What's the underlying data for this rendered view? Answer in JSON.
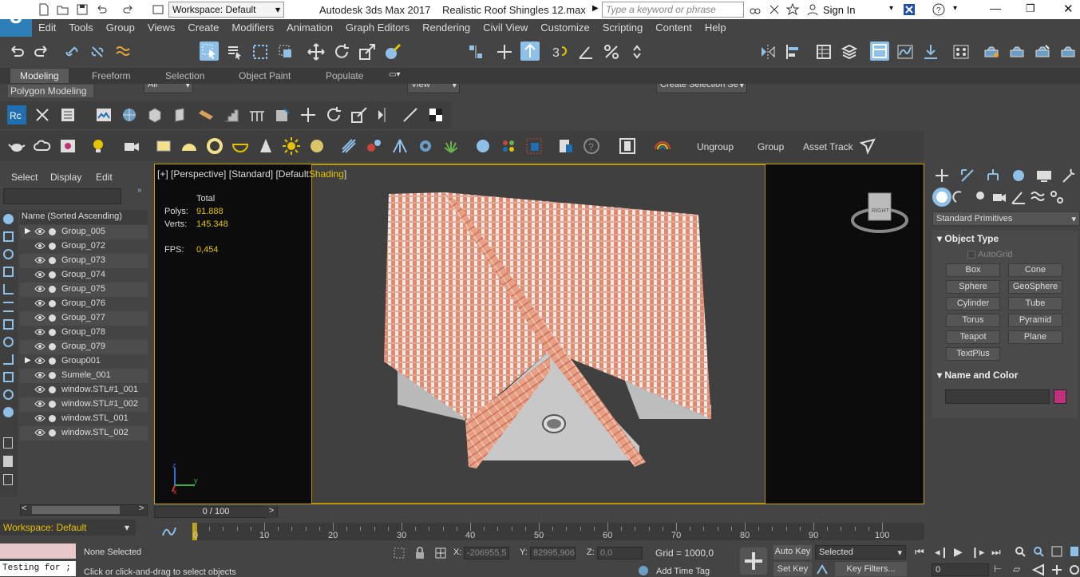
{
  "title_bar": {
    "workspace": "Workspace: Default",
    "app_title": "Autodesk 3ds Max 2017",
    "file_name": "Realistic Roof Shingles 12.max",
    "search_placeholder": "Type a keyword or phrase",
    "sign_in": "Sign In"
  },
  "logo_text": "3",
  "menu": [
    "Edit",
    "Tools",
    "Group",
    "Views",
    "Create",
    "Modifiers",
    "Animation",
    "Graph Editors",
    "Rendering",
    "Civil View",
    "Customize",
    "Scripting",
    "Content",
    "Help"
  ],
  "main_toolbar": {
    "filter_value": "All",
    "ref_coord_value": "View",
    "selection_set_placeholder": "Create Selection Se"
  },
  "ribbon": {
    "tabs": [
      "Modeling",
      "Freeform",
      "Selection",
      "Object Paint",
      "Populate"
    ],
    "panel_label": "Polygon Modeling"
  },
  "command_row2": {
    "ungroup": "Ungroup",
    "group": "Group",
    "asset_track": "Asset Track"
  },
  "scene_explorer": {
    "tabs": [
      "Select",
      "Display",
      "Edit"
    ],
    "header": "Name (Sorted Ascending)",
    "items": [
      {
        "name": "Group_005",
        "expandable": true
      },
      {
        "name": "Group_072",
        "expandable": false
      },
      {
        "name": "Group_073",
        "expandable": false
      },
      {
        "name": "Group_074",
        "expandable": false
      },
      {
        "name": "Group_075",
        "expandable": false
      },
      {
        "name": "Group_076",
        "expandable": false
      },
      {
        "name": "Group_077",
        "expandable": false
      },
      {
        "name": "Group_078",
        "expandable": false
      },
      {
        "name": "Group_079",
        "expandable": false
      },
      {
        "name": "Group001",
        "expandable": true
      },
      {
        "name": "Sumele_001",
        "expandable": false
      },
      {
        "name": "window.STL#1_001",
        "expandable": false
      },
      {
        "name": "window.STL#1_002",
        "expandable": false
      },
      {
        "name": "window.STL_001",
        "expandable": false
      },
      {
        "name": "window.STL_002",
        "expandable": false
      }
    ],
    "workspace_bottom": "Workspace: Default"
  },
  "viewport": {
    "label_plus": "[+]",
    "label_view": "[Perspective]",
    "label_shading_std": "[Standard]",
    "label_default": "[Default",
    "label_shading": "Shading",
    "label_close": "]",
    "stats_total": "Total",
    "polys_label": "Polys:",
    "polys_value": "91.888",
    "verts_label": "Verts:",
    "verts_value": "145.348",
    "fps_label": "FPS:",
    "fps_value": "0,454",
    "viewcube_label": "RIGHT",
    "axis_z": "z",
    "axis_y": "y",
    "axis_x": "x"
  },
  "command_panel": {
    "category": "Standard Primitives",
    "object_type_title": "Object Type",
    "autogrid": "AutoGrid",
    "buttons": [
      "Box",
      "Cone",
      "Sphere",
      "GeoSphere",
      "Cylinder",
      "Tube",
      "Torus",
      "Pyramid",
      "Teapot",
      "Plane",
      "TextPlus"
    ],
    "name_color_title": "Name and Color",
    "object_color": "#c2307a"
  },
  "timeline": {
    "frame_display": "0 / 100",
    "ticks": [
      "0",
      "10",
      "20",
      "30",
      "40",
      "50",
      "60",
      "70",
      "80",
      "90",
      "100"
    ]
  },
  "status_bar": {
    "maxscript": "Testing for ;",
    "selection": "None Selected",
    "prompt": "Click or click-and-drag to select objects",
    "x_label": "X:",
    "x_value": "-206955,5",
    "y_label": "Y:",
    "y_value": "82995,906",
    "z_label": "Z:",
    "z_value": "0,0",
    "grid": "Grid = 1000,0",
    "add_time_tag": "Add Time Tag",
    "auto_key": "Auto Key",
    "set_key": "Set Key",
    "selected_dd": "Selected",
    "key_filters": "Key Filters...",
    "frame_value": "0"
  },
  "colors": {
    "accent": "#e6c200",
    "roof": "#e48a6a",
    "wall": "#c8c8c8"
  }
}
